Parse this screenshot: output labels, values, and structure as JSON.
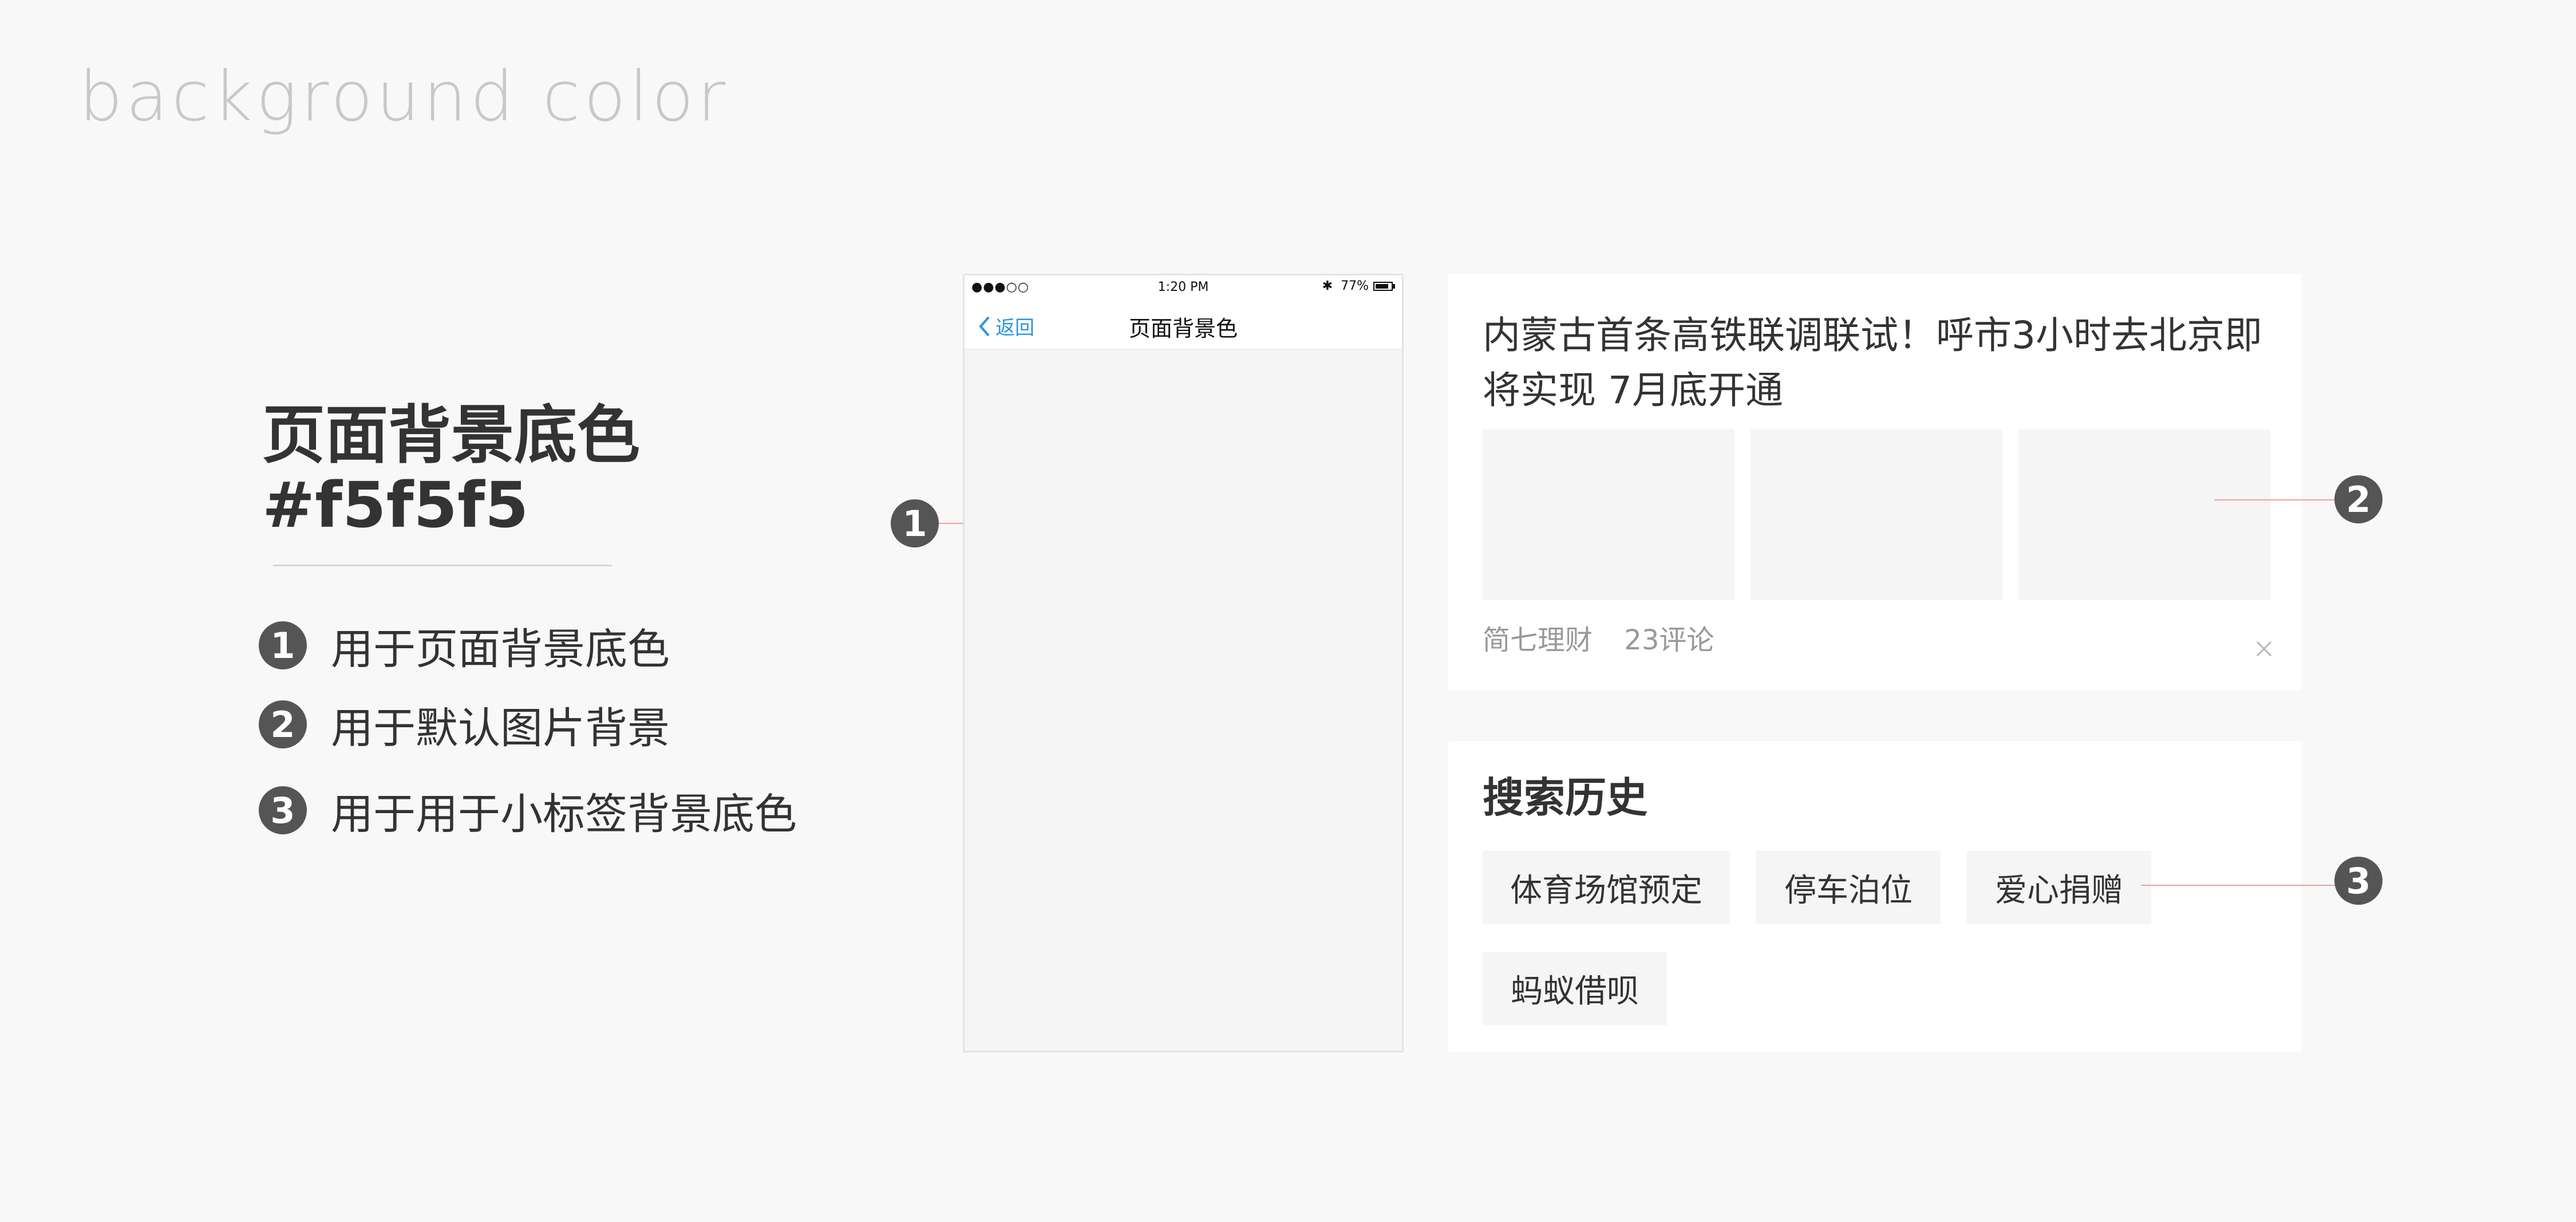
{
  "header": {
    "title": "background color"
  },
  "spec": {
    "name": "页面背景底色",
    "hex": "#f5f5f5",
    "usages": [
      {
        "num": "1",
        "text": "用于页面背景底色"
      },
      {
        "num": "2",
        "text": "用于默认图片背景"
      },
      {
        "num": "3",
        "text": "用于用于小标签背景底色"
      }
    ]
  },
  "phone": {
    "status": {
      "signal": "●●●○○",
      "time": "1:20 PM",
      "bluetooth": "✱",
      "battery": "77%"
    },
    "nav": {
      "back_label": "返回",
      "title": "页面背景色"
    }
  },
  "news": {
    "headline": "内蒙古首条高铁联调联试！呼市3小时去北京即将实现 7月底开通",
    "source": "简七理财",
    "comments": "23评论"
  },
  "search_history": {
    "title": "搜索历史",
    "tags": [
      "体育场馆预定",
      "停车泊位",
      "爱心捐赠",
      "蚂蚁借呗"
    ]
  },
  "colors": {
    "page_background": "#f5f5f5",
    "badge": "#555555",
    "callout_line": "#f0a0a0",
    "link": "#2a95e3"
  }
}
